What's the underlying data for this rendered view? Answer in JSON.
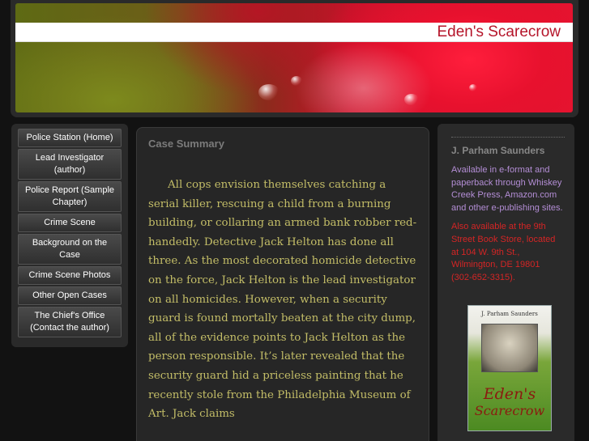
{
  "header": {
    "site_title": "Eden's Scarecrow"
  },
  "nav": {
    "items": [
      {
        "label": "Police Station (Home)"
      },
      {
        "label": "Lead Investigator (author)"
      },
      {
        "label": "Police Report (Sample Chapter)"
      },
      {
        "label": "Crime Scene"
      },
      {
        "label": "Background on the Case"
      },
      {
        "label": "Crime Scene Photos"
      },
      {
        "label": "Other Open Cases"
      },
      {
        "label": "The Chief's Office (Contact the author)"
      }
    ]
  },
  "content": {
    "heading": "Case Summary",
    "body": "All cops envision themselves catching a serial killer, rescuing a child from a burning building, or collaring an armed bank robber red-handedly. Detective Jack Helton has done all three. As the most decorated homicide detective on the force, Jack Helton is the lead investigator on all homicides. However, when a security guard is found mortally beaten at the city dump, all of the evidence points to Jack Helton as the person responsible. It’s later revealed that the security guard hid a priceless painting that he recently stole from the Philadelphia Museum of Art. Jack claims"
  },
  "sidebar": {
    "author_name": "J. Parham Saunders",
    "availability": "Available in e-format and paperback through Whiskey Creek Press, Amazon.com and other e-publishing sites.",
    "store": "Also available at the 9th Street Book Store, located at 104 W. 9th St., Wilmington, DE 19801 (302-652-3315).",
    "book": {
      "author": "J. Parham Saunders",
      "title_line1": "Eden's",
      "title_line2": "Scarecrow"
    }
  },
  "colors": {
    "title": "#b5152a",
    "body_text": "#c3bd67",
    "availability": "#b48ed6",
    "store": "#d42525"
  }
}
